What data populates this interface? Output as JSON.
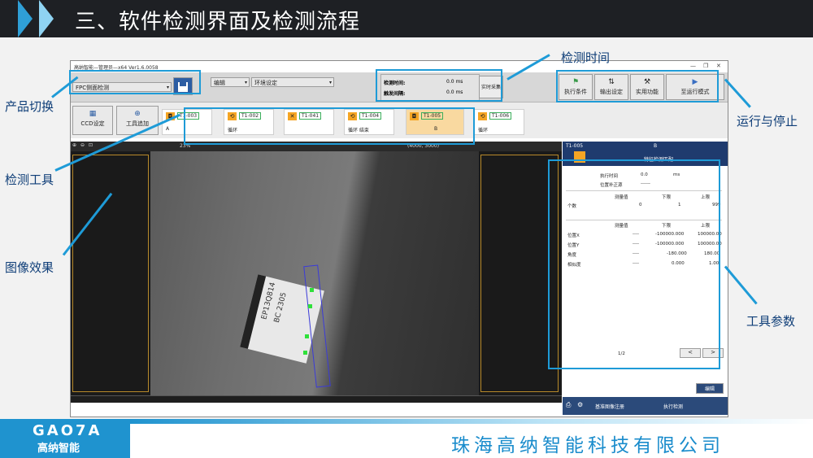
{
  "slide": {
    "title": "三、软件检测界面及检测流程",
    "company": "珠海高纳智能科技有限公司",
    "logo_text": "GAO7A",
    "logo_sub": "高纳智能"
  },
  "callouts": {
    "product_switch": "产品切换",
    "detect_tool": "检测工具",
    "image_effect": "图像效果",
    "detect_time": "检测时间",
    "run_stop": "运行与停止",
    "tool_params": "工具参数"
  },
  "window": {
    "title": "高纳智能—管理员—x64 Ver1.6.0058",
    "product": "FPC侧面检测",
    "edit": "编辑",
    "env_setting": "环境设定",
    "detect_time_label": "检测时间:",
    "detect_time_value": "0.0 ms",
    "trigger_interval_label": "触发间隔:",
    "trigger_interval_value": "0.0 ms",
    "realtime_capture": "实时采集",
    "exec_condition": "执行条件",
    "output_setting": "输出设定",
    "utility": "实用功能",
    "to_run_mode": "至运行模式",
    "ccd_setting": "CCD设定",
    "tool_add": "工具追加",
    "zoom": "23%",
    "resolution": "(4000, 3000)"
  },
  "tools": [
    {
      "id": "T1-003",
      "label": "A"
    },
    {
      "id": "T1-002",
      "label": "循环"
    },
    {
      "id": "T1-041",
      "label": ""
    },
    {
      "id": "T1-004",
      "label": "循环 结束"
    },
    {
      "id": "T1-005",
      "label": "B"
    },
    {
      "id": "T1-006",
      "label": "循环"
    }
  ],
  "panel": {
    "tool_id": "T1-005",
    "tool_name": "B",
    "subtitle": "特征检测匹配",
    "exec_time_label": "执行时间",
    "exec_time_value": "0.0",
    "exec_time_unit": "ms",
    "pos_comp_label": "位置补正源",
    "pos_comp_value": "------",
    "table1_headers": [
      "",
      "测量值",
      "下限",
      "上限"
    ],
    "table1_rows": [
      [
        "个数",
        "0",
        "1",
        "999"
      ]
    ],
    "table2_headers": [
      "",
      "测量值",
      "下限",
      "上限"
    ],
    "table2_rows": [
      [
        "位置X",
        "----",
        "-100000.000",
        "100000.00"
      ],
      [
        "位置Y",
        "----",
        "-100000.000",
        "100000.00"
      ],
      [
        "角度",
        "----",
        "-180.000",
        "180.00"
      ],
      [
        "相似度",
        "----",
        "0.000",
        "1.00"
      ]
    ],
    "page": "1/2",
    "prev": "<",
    "next": ">",
    "edit": "编辑",
    "base_register": "基准图像注册",
    "exec_detect": "执行检测"
  },
  "chip_text": [
    "EP13Q814",
    "BC  2305"
  ]
}
